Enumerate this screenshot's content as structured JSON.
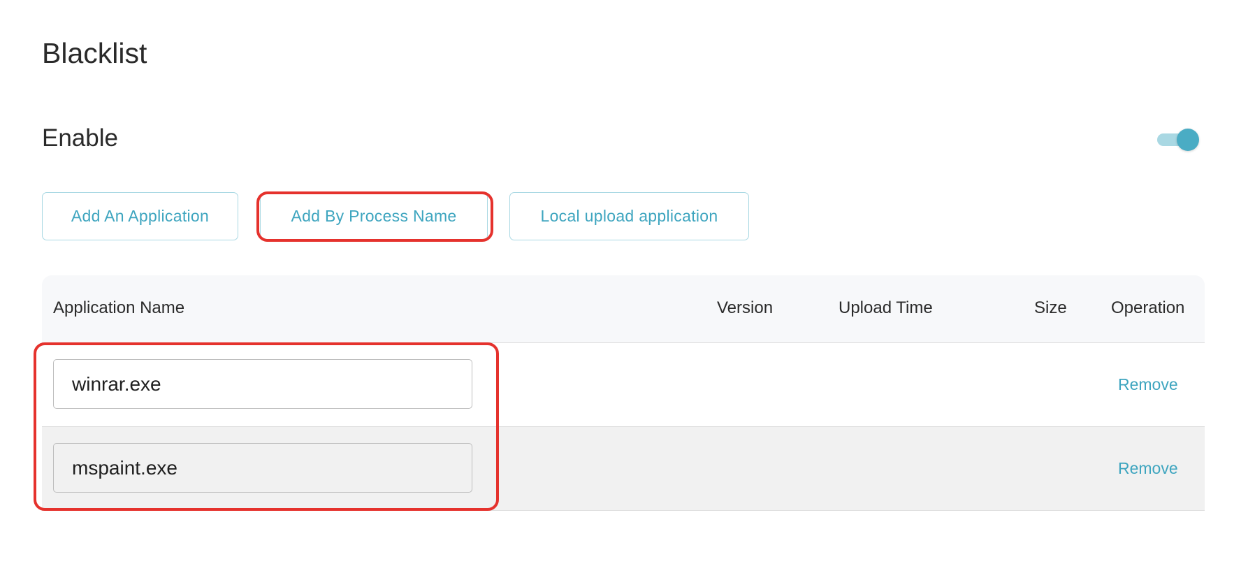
{
  "page": {
    "title": "Blacklist"
  },
  "enable": {
    "label": "Enable",
    "on": true,
    "accent_color": "#4aacc4"
  },
  "actions": {
    "add_application": "Add An Application",
    "add_by_process_name": "Add By Process Name",
    "local_upload": "Local upload application"
  },
  "table": {
    "columns": [
      "Application Name",
      "Version",
      "Upload Time",
      "Size",
      "Operation"
    ],
    "rows": [
      {
        "name": "winrar.exe",
        "version": "",
        "upload_time": "",
        "size": "",
        "operation": "Remove"
      },
      {
        "name": "mspaint.exe",
        "version": "",
        "upload_time": "",
        "size": "",
        "operation": "Remove"
      }
    ]
  },
  "annotations": {
    "highlight_color": "#e5322d"
  }
}
